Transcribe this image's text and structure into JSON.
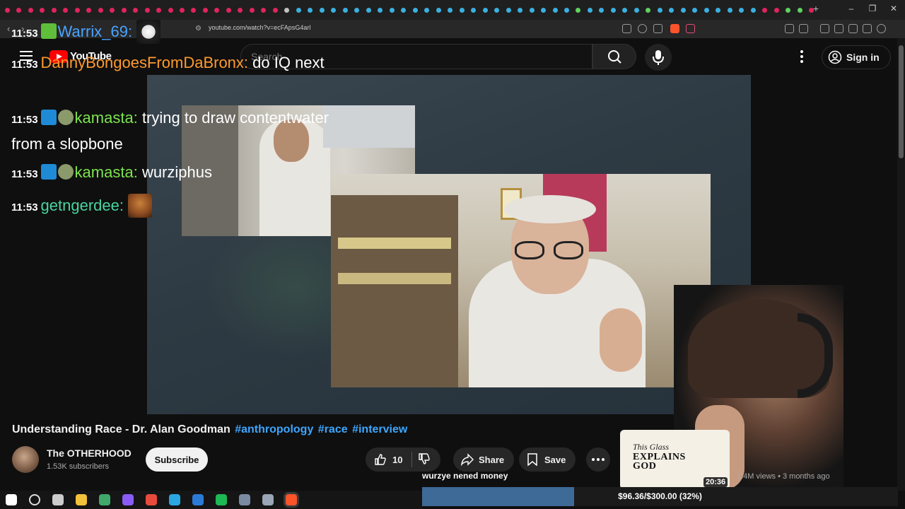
{
  "browser": {
    "url": "youtube.com/watch?v=ecFApsG4arl",
    "new_tab_label": "+",
    "window_controls": [
      "–",
      "❐",
      "✕"
    ],
    "tab_colors": [
      "#e0245e",
      "#e0245e",
      "#e0245e",
      "#e0245e",
      "#e0245e",
      "#e0245e",
      "#e0245e",
      "#e0245e",
      "#e0245e",
      "#e0245e",
      "#e0245e",
      "#e0245e",
      "#e0245e",
      "#e0245e",
      "#e0245e",
      "#e0245e",
      "#e0245e",
      "#e0245e",
      "#e0245e",
      "#e0245e",
      "#e0245e",
      "#e0245e",
      "#e0245e",
      "#e0245e",
      "#c0c0c0",
      "#3ab0e0",
      "#3ab0e0",
      "#3ab0e0",
      "#3ab0e0",
      "#3ab0e0",
      "#3ab0e0",
      "#3ab0e0",
      "#3ab0e0",
      "#3ab0e0",
      "#3ab0e0",
      "#3ab0e0",
      "#3ab0e0",
      "#3ab0e0",
      "#3ab0e0",
      "#3ab0e0",
      "#3ab0e0",
      "#3ab0e0",
      "#3ab0e0",
      "#3ab0e0",
      "#3ab0e0",
      "#3ab0e0",
      "#3ab0e0",
      "#3ab0e0",
      "#3ab0e0",
      "#5fd35f",
      "#3ab0e0",
      "#3ab0e0",
      "#3ab0e0",
      "#3ab0e0",
      "#3ab0e0",
      "#5fd35f",
      "#3ab0e0",
      "#3ab0e0",
      "#3ab0e0",
      "#3ab0e0",
      "#3ab0e0",
      "#3ab0e0",
      "#3ab0e0",
      "#3ab0e0",
      "#3ab0e0",
      "#e0245e",
      "#e0245e",
      "#5fd35f",
      "#5fd35f",
      "#e0245e"
    ]
  },
  "youtube": {
    "logo_text": "YouTube",
    "search_placeholder": "Search",
    "sign_in": "Sign in"
  },
  "chat": [
    {
      "time": "11:53",
      "user": "Warrix_69",
      "user_color": "#4aa3ff",
      "text": ""
    },
    {
      "time": "11:53",
      "user": "DannyBongoesFromDaBronx",
      "user_color": "#ff9a2e",
      "text": "do IQ next"
    },
    {
      "time": "11:53",
      "user": "kamasta",
      "user_color": "#7ce34f",
      "text": "trying to draw contentwater from a slopbone"
    },
    {
      "time": "11:53",
      "user": "kamasta",
      "user_color": "#7ce34f",
      "text": "wurziphus"
    },
    {
      "time": "11:53",
      "user": "getngerdee",
      "user_color": "#49d4a0",
      "text": ""
    }
  ],
  "video": {
    "title": "Understanding Race - Dr. Alan Goodman",
    "hashtags": [
      "#anthropology",
      "#race",
      "#interview"
    ],
    "channel": "The OTHERHOOD",
    "subscribers": "1.53K subscribers",
    "subscribe_label": "Subscribe",
    "likes": "10",
    "share_label": "Share",
    "save_label": "Save"
  },
  "recommended": {
    "thumb_line1": "This Glass",
    "thumb_line2": "EXPLAINS GOD",
    "duration": "20:36",
    "meta": "1.4M views • 3 months ago"
  },
  "donation": {
    "message": "wurzye nened money",
    "goal_text": "$96.36/$300.00 (32%)",
    "progress": 0.32
  },
  "taskbar": {
    "icon_colors": [
      "#ffffff",
      "#dddddd",
      "#cccccc",
      "#f2c23a",
      "#3fa86a",
      "#8a5cf6",
      "#e84b3c",
      "#2aa6e0",
      "#2b7bd6",
      "#1db954",
      "#7a8aa0",
      "#9aa5b5",
      "#fb542b"
    ]
  }
}
